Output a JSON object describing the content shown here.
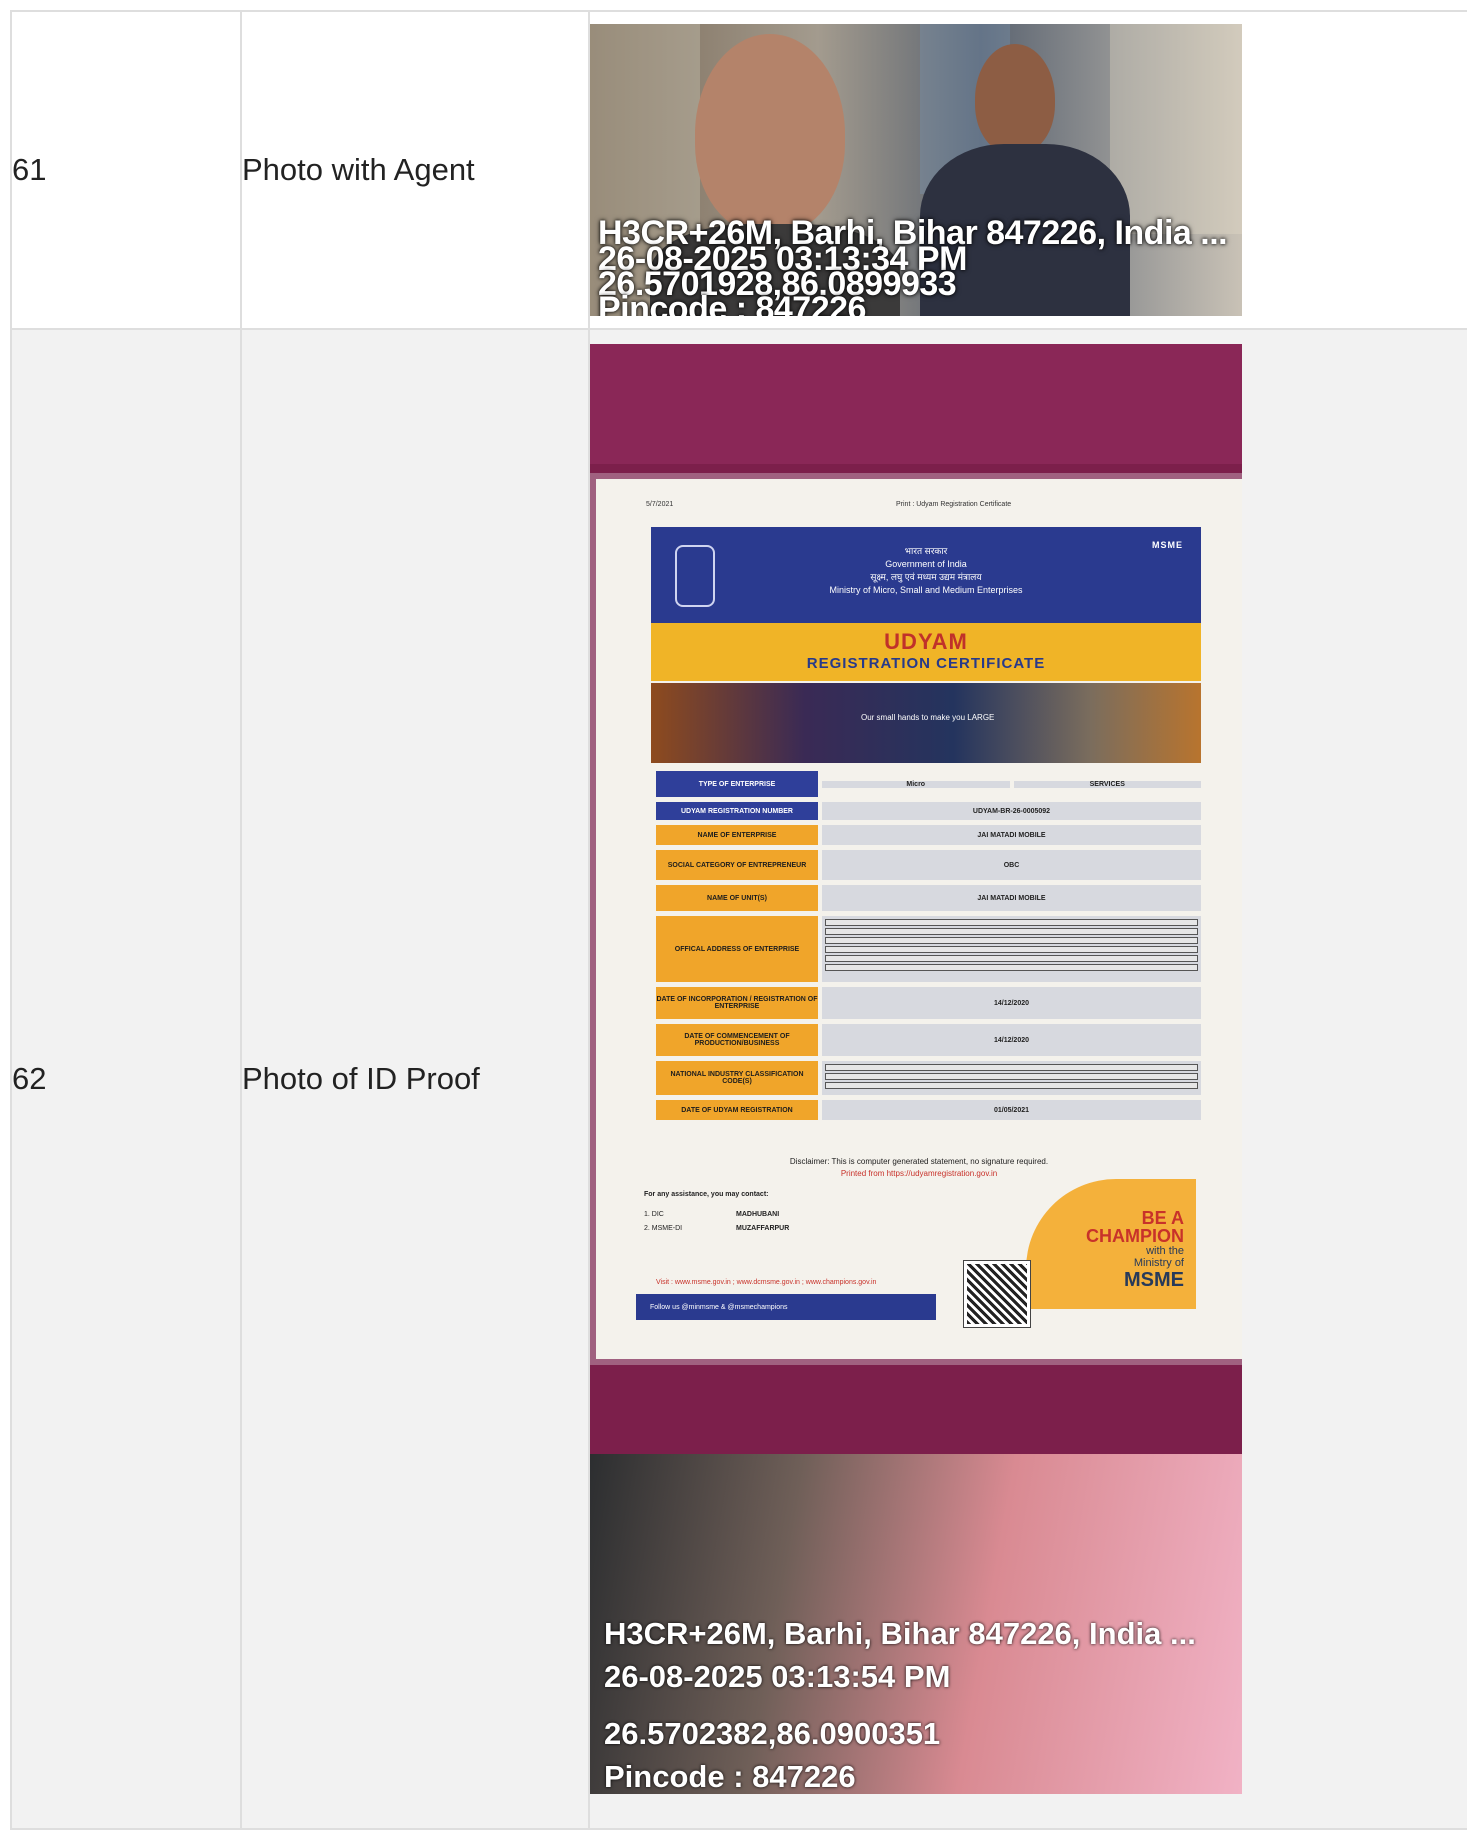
{
  "rows": [
    {
      "number": "61",
      "label": "Photo with Agent",
      "photo": {
        "stamp": [
          "H3CR+26M, Barhi, Bihar 847226, India ...",
          "26-08-2025 03:13:34 PM",
          "26.5701928,86.0899933",
          "Pincode : 847226"
        ]
      }
    },
    {
      "number": "62",
      "label": "Photo of ID Proof",
      "photo": {
        "certificate": {
          "top_left": "5/7/2021",
          "top_center": "Print : Udyam Registration Certificate",
          "gov_hi": "भारत सरकार",
          "gov_en": "Government of India",
          "ministry_hi": "सूक्ष्म, लघु एवं मध्यम उद्यम मंत्रालय",
          "ministry_en": "Ministry of Micro, Small and Medium Enterprises",
          "logo": "MSME",
          "title": "UDYAM",
          "subtitle": "REGISTRATION CERTIFICATE",
          "banner_text": "Our small hands to make you LARGE",
          "fields": [
            {
              "key": "TYPE OF ENTERPRISE",
              "v1": "Micro",
              "v2": "SERVICES"
            },
            {
              "key": "UDYAM REGISTRATION NUMBER",
              "value": "UDYAM-BR-26-0005092"
            },
            {
              "key": "NAME OF ENTERPRISE",
              "value": "JAI MATADI MOBILE"
            },
            {
              "key": "SOCIAL CATEGORY OF ENTREPRENEUR",
              "value": "OBC"
            },
            {
              "key": "NAME OF UNIT(S)",
              "value": "JAI MATADI MOBILE"
            },
            {
              "key": "OFFICAL ADDRESS OF ENTERPRISE",
              "value": ""
            },
            {
              "key": "DATE OF INCORPORATION / REGISTRATION OF ENTERPRISE",
              "value": "14/12/2020"
            },
            {
              "key": "DATE OF COMMENCEMENT OF PRODUCTION/BUSINESS",
              "value": "14/12/2020"
            },
            {
              "key": "NATIONAL INDUSTRY CLASSIFICATION CODE(S)",
              "value": ""
            },
            {
              "key": "DATE OF UDYAM REGISTRATION",
              "value": "01/05/2021"
            }
          ],
          "disclaimer": "Disclaimer: This is computer generated statement, no signature required.",
          "printed_from": "Printed from https://udyamregistration.gov.in",
          "assistance": "For any assistance, you may contact:",
          "contacts": [
            {
              "label": "1. DIC",
              "value": "MADHUBANI"
            },
            {
              "label": "2. MSME-DI",
              "value": "MUZAFFARPUR"
            }
          ],
          "champion_a": "BE A",
          "champion_b": "CHAMPION",
          "champion_c": "with the",
          "champion_d": "Ministry of",
          "champion_e": "MSME",
          "visit": "Visit : www.msme.gov.in ; www.dcmsme.gov.in ; www.champions.gov.in",
          "follow": "Follow us @minmsme & @msmechampions"
        },
        "stamp": [
          "H3CR+26M, Barhi, Bihar 847226, India ...",
          "26-08-2025 03:13:54 PM",
          "26.5702382,86.0900351",
          "Pincode : 847226"
        ]
      }
    }
  ]
}
